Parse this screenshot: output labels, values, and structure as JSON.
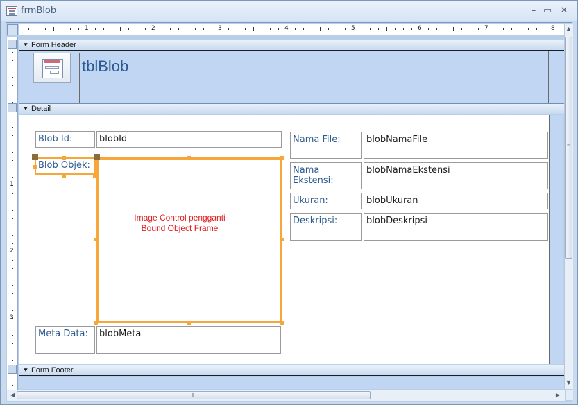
{
  "window": {
    "title": "frmBlob",
    "minimize_glyph": "–",
    "restore_glyph": "▭",
    "close_glyph": "✕",
    "icon": "form-icon"
  },
  "ruler": {
    "top_numbers": [
      "1",
      "2",
      "3",
      "4",
      "5",
      "6",
      "7",
      "8"
    ],
    "left_numbers": [
      "1",
      "2",
      "3"
    ]
  },
  "sections": {
    "header": {
      "label": "Form Header",
      "title": "tblBlob"
    },
    "detail": {
      "label": "Detail"
    },
    "footer": {
      "label": "Form Footer"
    }
  },
  "detail": {
    "blob_id": {
      "label": "Blob Id:",
      "field": "blobId"
    },
    "blob_objek": {
      "label": "Blob Objek:"
    },
    "image_control": {
      "caption_line1": "Image Control pengganti",
      "caption_line2": "Bound Object Frame"
    },
    "meta_data": {
      "label": "Meta Data:",
      "field": "blobMeta"
    },
    "nama_file": {
      "label": "Nama File:",
      "field": "blobNamaFile"
    },
    "nama_ekstensi": {
      "label": "Nama Ekstensi:",
      "field": "blobNamaEkstensi"
    },
    "ukuran": {
      "label": "Ukuran:",
      "field": "blobUkuran"
    },
    "deskripsi": {
      "label": "Deskripsi:",
      "field": "blobDeskripsi"
    }
  },
  "colors": {
    "label_text": "#2b5a92",
    "selection": "#f7a73a",
    "caption": "#e01c1c",
    "section_bg": "#c0d6f3"
  }
}
